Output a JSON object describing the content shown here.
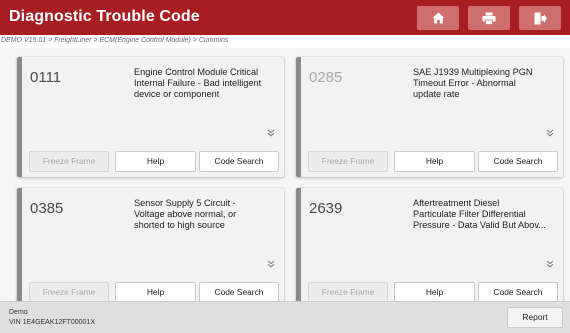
{
  "header": {
    "title": "Diagnostic Trouble Code",
    "home_icon": "home-icon",
    "print_icon": "printer-icon",
    "exit_icon": "exit-icon"
  },
  "breadcrumb": {
    "text": "DEMO V15.01 > FreightLiner > ECM(Engine Control Module) > Cummins"
  },
  "cards": [
    {
      "code": "0111",
      "description": "Engine Control Module Critical\nInternal Failure - Bad intelligent\ndevice or component",
      "buttons": {
        "freeze": "Freeze Frame",
        "help": "Help",
        "search": "Code Search"
      }
    },
    {
      "code": "0285",
      "description": "SAE J1939 Multiplexing PGN\nTimeout Error - Abnormal\nupdate rate",
      "buttons": {
        "freeze": "Freeze Frame",
        "help": "Help",
        "search": "Code Search"
      }
    },
    {
      "code": "0385",
      "description": "Sensor Supply 5 Circuit -\nVoltage above normal, or\nshorted to high source",
      "buttons": {
        "freeze": "Freeze Frame",
        "help": "Help",
        "search": "Code Search"
      }
    },
    {
      "code": "2639",
      "description": "Aftertreatment Diesel\nParticulate Filter Differential\nPressure - Data Valid But Abov...",
      "buttons": {
        "freeze": "Freeze Frame",
        "help": "Help",
        "search": "Code Search"
      }
    }
  ],
  "footer": {
    "line1": "Demo",
    "line2": "VIN 1E4GEAK12FT00001X",
    "report_label": "Report"
  },
  "colors": {
    "header_bg": "#a81d22",
    "header_button_bg": "#cf6e6e",
    "card_stripe": "#8a8a8a"
  }
}
